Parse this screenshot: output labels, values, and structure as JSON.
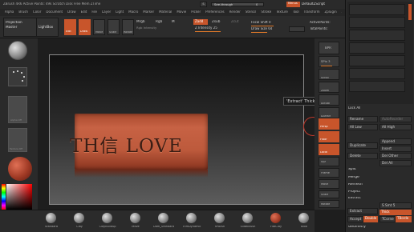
{
  "window": {
    "title": "ZBrush 4R6   Active Points: 49k   Scratch Disk   Free Mem   ZTime"
  },
  "menu": [
    "Alpha",
    "Brush",
    "Color",
    "Document",
    "Draw",
    "Edit",
    "File",
    "Layer",
    "Light",
    "Macro",
    "Marker",
    "Material",
    "Movie",
    "Picker",
    "Preferences",
    "Render",
    "Stencil",
    "Stroke",
    "Texture",
    "Tool",
    "Transform",
    "Zplugin",
    "Zscript"
  ],
  "header_right": {
    "seethrough_label": "See-through",
    "seethrough_value": "0",
    "menus_label": "Menus",
    "script_label": "DefaultZScript"
  },
  "topbar": {
    "proj_label": "Projection",
    "proj_sub": "Master",
    "lightbox_label": "LightBox",
    "edit_label": "Edit",
    "draw_label": "Draw",
    "move_label": "Move",
    "scale_label": "Scale",
    "rotate_label": "Rotate",
    "mrgb_label": "Mrgb",
    "rgb_label": "Rgb",
    "m_label": "M",
    "zadd_label": "Zadd",
    "zsub_label": "Zsub",
    "zcut_label": "Zcut",
    "rgb_intensity_label": "Rgb Intensity",
    "z_intensity_label": "Z Intensity 25",
    "focal_label": "Focal Shift 0",
    "drawsize_label": "Draw Size 64",
    "activepoints_label": "ActivePoints:",
    "totalpoints_label": "TotalPoints:"
  },
  "canvas": {
    "text": "TH信 LOVE",
    "tooltip": "'Extract' Thickness"
  },
  "righttray": {
    "bpr_label": "BPR",
    "spix_label": "SPix 3",
    "scroll_label": "Scroll",
    "zoom_label": "Zoom",
    "actual_label": "Actual",
    "aahalf_label": "AAHalf",
    "persp_label": "Persp",
    "floor_label": "Floor",
    "local_label": "Local",
    "xyz_label": "xyz",
    "frame_label": "Frame",
    "move_label": "Move",
    "scale_label": "Scale",
    "rotate_label": "Rotate",
    "polyf_label": "PolyF",
    "transp_label": "Transp",
    "ghost_label": "Ghost",
    "solo_label": "Solo",
    "xpose_label": "Xpose"
  },
  "lefttray": {
    "gradient_label": "Gradient",
    "alpha_label": "Alpha Off",
    "texture_label": "Texture Off"
  },
  "bottombar": {
    "brushes": [
      "Standard",
      "Clay",
      "ClayBuildup",
      "Move",
      "Dam_Standard",
      "TrimDynamic",
      "hPolish",
      "SlideBrush",
      "FlatClay",
      "Blob"
    ]
  },
  "rpanel": {
    "lock_label": "Lock All",
    "rename": "Rename",
    "autoreorder": "AutoReorder",
    "all_low": "All Low",
    "all_high": "All High",
    "duplicate": "Duplicate",
    "append": "Append",
    "insert": "Insert",
    "delete": "Delete",
    "del_other": "Del Other",
    "del_all": "Del All",
    "split": "Split",
    "merge": "Merge",
    "remesh": "Remesh",
    "project": "Project",
    "extract_header": "Extract",
    "smt_label": "S Smt 5",
    "extract_btn": "Extract",
    "thick_label": "Thick",
    "accept": "Accept",
    "double": "Double",
    "tcorner": "TCorne",
    "tborder": "TBorde",
    "geometry_header": "Geometry"
  }
}
